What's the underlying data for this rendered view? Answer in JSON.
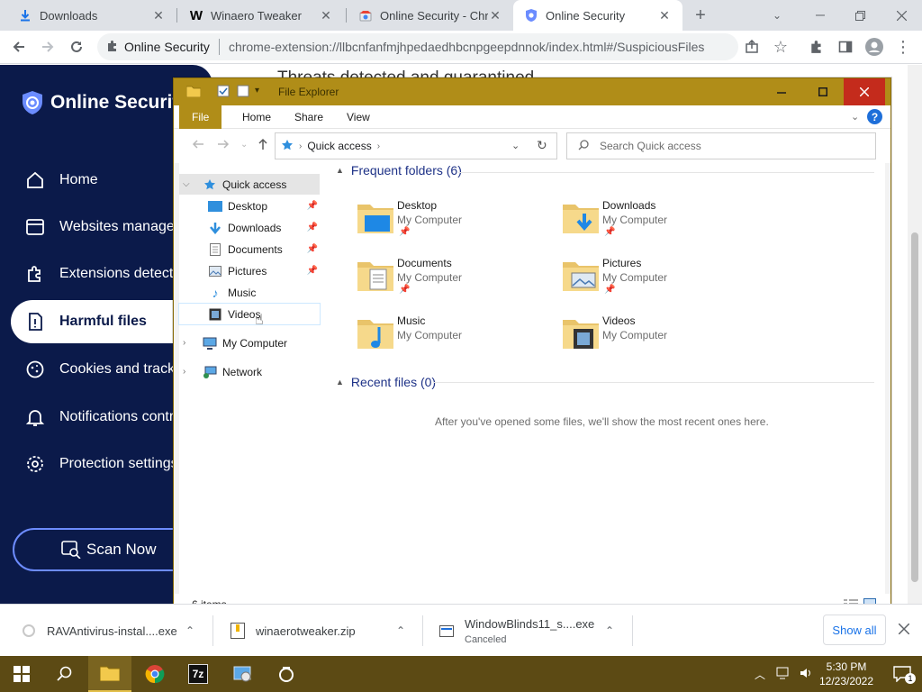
{
  "browser": {
    "tabs": [
      {
        "title": "Downloads",
        "icon": "download-icon"
      },
      {
        "title": "Winaero Tweaker",
        "icon": "winaero-w-icon"
      },
      {
        "title": "Online Security - Chro",
        "icon": "chrome-store-icon"
      },
      {
        "title": "Online Security",
        "icon": "shield-icon"
      }
    ],
    "new_tab_label": "+",
    "address": {
      "site_label": "Online Security",
      "url": "chrome-extension://llbcnfanfmjhpedaedhbcnpgeepdnnok/index.html#/SuspiciousFiles"
    }
  },
  "extension": {
    "brand": "Online Security",
    "heading_peek": "Threats detected and quarantined",
    "nav": [
      {
        "label": "Home",
        "icon": "home-icon"
      },
      {
        "label": "Websites management",
        "icon": "browser-window-icon"
      },
      {
        "label": "Extensions detection",
        "icon": "puzzle-icon"
      },
      {
        "label": "Harmful files",
        "icon": "file-warning-icon"
      },
      {
        "label": "Cookies and trackers",
        "icon": "cookie-icon"
      },
      {
        "label": "Notifications control",
        "icon": "bell-icon"
      },
      {
        "label": "Protection settings",
        "icon": "gear-icon"
      }
    ],
    "scan_button": "Scan Now",
    "accent": "#0b1a4a"
  },
  "explorer": {
    "title": "File Explorer",
    "ribbon_tabs": [
      "File",
      "Home",
      "Share",
      "View"
    ],
    "address_path": "Quick access",
    "search_placeholder": "Search Quick access",
    "tree": {
      "quick_access": "Quick access",
      "pinned": [
        "Desktop",
        "Downloads",
        "Documents",
        "Pictures"
      ],
      "unpinned": [
        "Music",
        "Videos"
      ],
      "my_computer": "My Computer",
      "network": "Network"
    },
    "frequent_header": "Frequent folders (6)",
    "folders": [
      {
        "name": "Desktop",
        "location": "My Computer",
        "pinned": true
      },
      {
        "name": "Downloads",
        "location": "My Computer",
        "pinned": true
      },
      {
        "name": "Documents",
        "location": "My Computer",
        "pinned": true
      },
      {
        "name": "Pictures",
        "location": "My Computer",
        "pinned": true
      },
      {
        "name": "Music",
        "location": "My Computer",
        "pinned": false
      },
      {
        "name": "Videos",
        "location": "My Computer",
        "pinned": false
      }
    ],
    "recent_header": "Recent files (0)",
    "recent_empty": "After you've opened some files, we'll show the most recent ones here.",
    "status": "6 items",
    "frame_color": "#b08d18"
  },
  "downloads": {
    "items": [
      {
        "name": "RAVAntivirus-instal....exe",
        "status": ""
      },
      {
        "name": "winaerotweaker.zip",
        "status": ""
      },
      {
        "name": "WindowBlinds11_s....exe",
        "status": "Canceled"
      }
    ],
    "show_all": "Show all"
  },
  "taskbar": {
    "time": "5:30 PM",
    "date": "12/23/2022",
    "notification_count": "1"
  }
}
